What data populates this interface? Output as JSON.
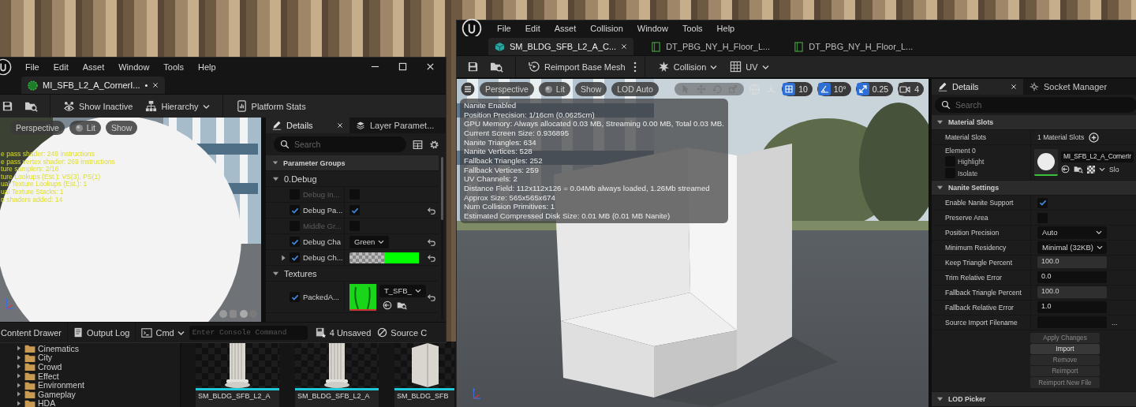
{
  "material_window": {
    "menu": [
      "File",
      "Edit",
      "Asset",
      "Window",
      "Tools",
      "Help"
    ],
    "tab": {
      "label": "MI_SFB_L2_A_CornerI...",
      "unsaved_mark": "•"
    },
    "toolbar": [
      {
        "kind": "button",
        "label": "Show Inactive"
      },
      {
        "kind": "dropdown",
        "label": "Hierarchy"
      },
      {
        "kind": "button",
        "label": "Platform Stats"
      }
    ],
    "viewport": {
      "buttons": [
        "Perspective",
        "Lit",
        "Show"
      ],
      "stats": [
        "e pass shader: 249 instructions",
        "e pass vertex shader: 269 instructions",
        "ture samplers: 2/16",
        "ture Lookups (Est.): VS(3), PS(1)",
        "ual Texture Lookups (Est.): 1",
        "ual Texture Stacks: 1",
        "n shaders added: 14"
      ]
    },
    "details": {
      "tabs": [
        {
          "label": "Details",
          "selected": true
        },
        {
          "label": "Layer Paramet...",
          "selected": false
        }
      ],
      "search": {
        "placeholder": "Search"
      },
      "header": "Parameter Groups",
      "groups": [
        {
          "name": "0.Debug",
          "expanded": true,
          "params": [
            {
              "kind": "checkbox",
              "name": "Debug In...",
              "enabled": false,
              "value": false,
              "resettable": false
            },
            {
              "kind": "checkbox",
              "name": "Debug Pa...",
              "enabled": true,
              "value": true,
              "resettable": true
            },
            {
              "kind": "checkbox",
              "name": "Middle Gr...",
              "enabled": false,
              "value": false,
              "resettable": false
            },
            {
              "kind": "dropdown",
              "name": "Debug Cha",
              "enabled": true,
              "value": "Green",
              "resettable": true
            },
            {
              "kind": "color",
              "name": "Debug Ch...",
              "enabled": true,
              "expanded": false,
              "color": "#00ff00",
              "resettable": true
            }
          ]
        },
        {
          "name": "Textures",
          "expanded": true,
          "params": [
            {
              "kind": "texture",
              "name": "PackedA...",
              "enabled": true,
              "value": "T_SFB_",
              "resettable": true
            }
          ]
        }
      ]
    },
    "status_bar": {
      "buttons": [
        "Content Drawer",
        "Output Log"
      ],
      "cmd": "Cmd",
      "console": {
        "placeholder": "Enter Console Command"
      },
      "unsaved": "4 Unsaved",
      "source_control": "Source C"
    }
  },
  "mesh_window": {
    "menu": [
      "File",
      "Edit",
      "Asset",
      "Collision",
      "Window",
      "Tools",
      "Help"
    ],
    "tabs": [
      {
        "kind": "mesh",
        "label": "SM_BLDG_SFB_L2_A_C...",
        "selected": true
      },
      {
        "kind": "table",
        "label": "DT_PBG_NY_H_Floor_L...",
        "selected": false
      },
      {
        "kind": "table",
        "label": "DT_PBG_NY_H_Floor_L...",
        "selected": false
      }
    ],
    "toolbar": [
      {
        "kind": "split",
        "label": "Reimport Base Mesh"
      },
      {
        "kind": "dropdown",
        "label": "Collision"
      },
      {
        "kind": "dropdown",
        "label": "UV"
      }
    ],
    "viewport": {
      "buttons": [
        "Perspective",
        "Lit",
        "Show",
        "LOD Auto"
      ],
      "snaps": [
        {
          "kind": "grid",
          "value": "10"
        },
        {
          "kind": "angle",
          "value": "10°"
        },
        {
          "kind": "scale",
          "value": "0.25"
        },
        {
          "kind": "camera",
          "value": "4"
        }
      ],
      "stats": [
        "Nanite Enabled",
        "Position Precision: 1/16cm (0.0625cm)",
        "GPU Memory: Always allocated 0.03 MB, Streaming 0.00 MB, Total 0.03 MB.",
        "Current Screen Size: 0.936895",
        "Nanite Triangles: 634",
        "Nanite Vertices: 528",
        "Fallback Triangles: 252",
        "Fallback Vertices: 259",
        "UV Channels: 2",
        "Distance Field: 112x112x126 = 0.04Mb always loaded, 1.26Mb streamed",
        "Approx Size: 565x565x674",
        "Num Collision Primitives: 1",
        "Estimated Compressed Disk Size: 0.01 MB (0.01 MB Nanite)"
      ]
    },
    "details": {
      "tabs": [
        {
          "label": "Details",
          "selected": true
        },
        {
          "label": "Socket Manager",
          "selected": false
        }
      ],
      "search": {
        "placeholder": "Search"
      },
      "sections": [
        {
          "kind": "materials",
          "title": "Material Slots",
          "expanded": true,
          "label": "Material Slots",
          "count": "1 Material Slots",
          "element": "Element 0",
          "options": [
            {
              "label": "Highlight",
              "checked": false
            },
            {
              "label": "Isolate",
              "checked": false
            }
          ],
          "material": "MI_SFB_L2_A_CornerIr",
          "slot": "Slo"
        },
        {
          "kind": "properties",
          "title": "Nanite Settings",
          "expanded": true,
          "rows": [
            {
              "kind": "checkbox",
              "label": "Enable Nanite Support",
              "checked": true
            },
            {
              "kind": "checkbox",
              "label": "Preserve Area",
              "checked": false
            },
            {
              "kind": "dropdown",
              "label": "Position Precision",
              "value": "Auto"
            },
            {
              "kind": "dropdown",
              "label": "Minimum Residency",
              "value": "Minimal (32KB)"
            },
            {
              "kind": "number",
              "label": "Keep Triangle Percent",
              "value": "100.0",
              "disabled": true
            },
            {
              "kind": "number",
              "label": "Trim Relative Error",
              "value": "0.0",
              "disabled": false
            },
            {
              "kind": "number",
              "label": "Fallback Triangle Percent",
              "value": "100.0",
              "disabled": true
            },
            {
              "kind": "number",
              "label": "Fallback Relative Error",
              "value": "1.0",
              "disabled": false
            },
            {
              "kind": "file",
              "label": "Source Import Filename",
              "browse": "..."
            }
          ],
          "buttons": [
            {
              "label": "Apply Changes",
              "disabled": true
            },
            {
              "label": "Import",
              "disabled": false
            },
            {
              "label": "Remove",
              "disabled": true
            },
            {
              "label": "Reimport",
              "disabled": true
            },
            {
              "label": "Reimport New File",
              "disabled": true
            }
          ]
        },
        {
          "kind": "properties",
          "title": "LOD Picker",
          "expanded": true
        }
      ]
    }
  },
  "content_browser": {
    "folders": [
      "Cinematics",
      "City",
      "Crowd",
      "Effect",
      "Environment",
      "Gameplay",
      "HDA"
    ],
    "assets": [
      {
        "kind": "column",
        "label": "SM_BLDG_SFB_L2_A"
      },
      {
        "kind": "column",
        "label": "SM_BLDG_SFB_L2_A"
      },
      {
        "kind": "block",
        "label": "SM_BLDG_SFB"
      }
    ]
  }
}
